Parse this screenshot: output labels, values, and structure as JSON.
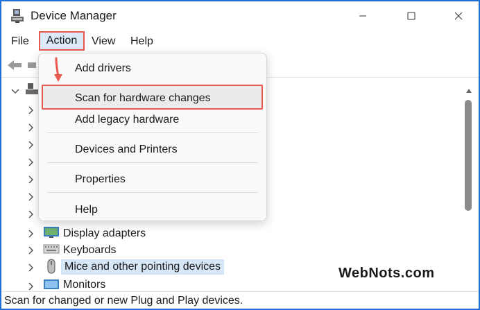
{
  "window": {
    "title": "Device Manager"
  },
  "menubar": {
    "items": [
      "File",
      "Action",
      "View",
      "Help"
    ]
  },
  "action_menu": {
    "items": [
      "Add drivers",
      "Scan for hardware changes",
      "Add legacy hardware",
      "Devices and Printers",
      "Properties",
      "Help"
    ],
    "highlighted": "Scan for hardware changes"
  },
  "tree": {
    "visible_items": [
      "Display adapters",
      "Keyboards",
      "Mice and other pointing devices",
      "Monitors"
    ],
    "selected": "Mice and other pointing devices"
  },
  "status": {
    "text": "Scan for changed or new Plug and Play devices."
  },
  "watermark": {
    "text": "WebNots.com"
  },
  "colors": {
    "frame": "#1f6fd6",
    "highlight_border": "#e8584f",
    "selection": "#d7e7f8"
  },
  "icons": {
    "app": "device-manager-icon",
    "back": "back-arrow-icon",
    "forward": "forward-arrow-icon",
    "minimize": "minimize-icon",
    "maximize": "maximize-icon",
    "close": "close-icon"
  }
}
